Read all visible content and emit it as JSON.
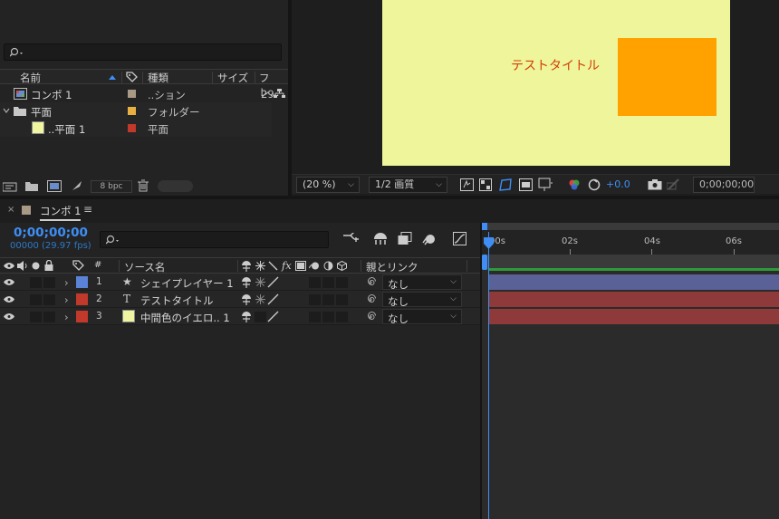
{
  "project": {
    "search_placeholder": "",
    "columns": {
      "name": "名前",
      "type": "種類",
      "size": "サイズ",
      "frame": "フレ..."
    },
    "items": [
      {
        "name": "コンポ 1",
        "type": "..ション",
        "size": "29",
        "label_color": "#a89a84",
        "indent": 0,
        "icon": "composition-icon"
      },
      {
        "name": "平面",
        "type": "フォルダー",
        "size": "",
        "label_color": "#e8b040",
        "indent": 0,
        "icon": "folder-icon"
      },
      {
        "name": "..平面 1",
        "type": "平面",
        "size": "",
        "label_color": "#c0392b",
        "indent": 1,
        "icon": "solid-swatch-icon",
        "swatch": "#f0f5a0"
      }
    ],
    "bpc": "8 bpc"
  },
  "viewer": {
    "title_text": "テストタイトル",
    "title_color": "#d2400a",
    "bg_color": "#eef59a",
    "shape_color": "#ffa200",
    "zoom": "(20 %)",
    "resolution": "1/2 画質",
    "exposure": "+0.0",
    "timecode": "0;00;00;00"
  },
  "timeline": {
    "tab_label": "コンポ 1",
    "timecode": "0;00;00;00",
    "frames": "00000 (29.97 fps)",
    "search_placeholder": "",
    "header": {
      "num": "#",
      "source": "ソース名",
      "parent": "親とリンク"
    },
    "ruler": [
      "00s",
      "02s",
      "04s",
      "06s"
    ],
    "layers": [
      {
        "num": "1",
        "name": "シェイプレイヤー 1",
        "label_color": "#5a82d6",
        "type": "shape",
        "parent": "なし",
        "bar_color": "#5a6196"
      },
      {
        "num": "2",
        "name": "テストタイトル",
        "label_color": "#c0392b",
        "type": "text",
        "parent": "なし",
        "bar_color": "#8e3a3a"
      },
      {
        "num": "3",
        "name": "中間色のイエロ.. 1",
        "label_color": "#c0392b",
        "type": "solid",
        "parent": "なし",
        "bar_color": "#8e3a3a"
      }
    ],
    "accent": "#2d8ceb"
  }
}
